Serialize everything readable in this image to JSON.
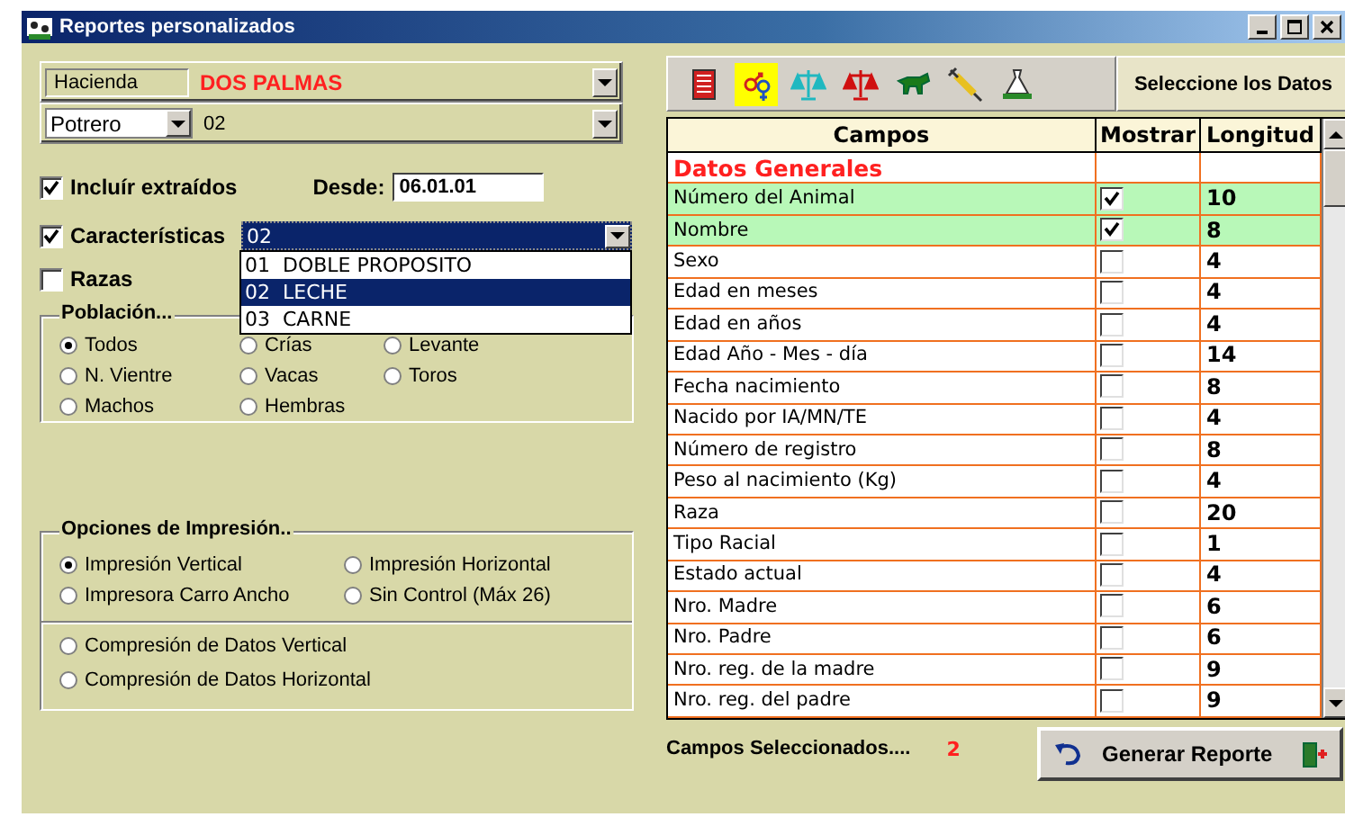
{
  "window": {
    "title": "Reportes personalizados"
  },
  "hacienda": {
    "label": "Hacienda",
    "value": "DOS PALMAS"
  },
  "potrero": {
    "label": "Potrero",
    "value": "02"
  },
  "incluir": {
    "label": "Incluír extraídos",
    "checked": true
  },
  "desde": {
    "label": "Desde:",
    "value": "06.01.01"
  },
  "caracteristicas": {
    "label": "Características",
    "checked": true,
    "value": "02",
    "options": [
      {
        "label": "01  DOBLE PROPOSITO",
        "selected": false
      },
      {
        "label": "02  LECHE",
        "selected": true
      },
      {
        "label": "03  CARNE",
        "selected": false
      }
    ]
  },
  "razas": {
    "label": "Razas",
    "checked": false
  },
  "poblacion": {
    "title": "Población...",
    "options": [
      {
        "label": "Todos",
        "selected": true
      },
      {
        "label": "Crías",
        "selected": false
      },
      {
        "label": "Levante",
        "selected": false
      },
      {
        "label": "N. Vientre",
        "selected": false
      },
      {
        "label": "Vacas",
        "selected": false
      },
      {
        "label": "Toros",
        "selected": false
      },
      {
        "label": "Machos",
        "selected": false
      },
      {
        "label": "Hembras",
        "selected": false
      }
    ]
  },
  "impresion": {
    "title": "Opciones de Impresión..",
    "options": [
      {
        "label": "Impresión Vertical",
        "selected": true
      },
      {
        "label": "Impresión Horizontal",
        "selected": false
      },
      {
        "label": "Impresora Carro Ancho",
        "selected": false
      },
      {
        "label": "Sin Control (Máx 26)",
        "selected": false
      }
    ],
    "compression": [
      {
        "label": "Compresión de Datos Vertical",
        "selected": false
      },
      {
        "label": "Compresión de Datos Horizontal",
        "selected": false
      }
    ]
  },
  "toolbar": {
    "tools": [
      {
        "kind": "document",
        "selected": false
      },
      {
        "kind": "gender",
        "selected": true
      },
      {
        "kind": "scale",
        "color": "#20b8c0",
        "selected": false
      },
      {
        "kind": "scale",
        "color": "#d01010",
        "selected": false
      },
      {
        "kind": "animal",
        "selected": false
      },
      {
        "kind": "syringe",
        "selected": false
      },
      {
        "kind": "sack",
        "selected": false
      }
    ],
    "label": "Seleccione los Datos"
  },
  "table": {
    "columns": [
      "Campos",
      "Mostrar",
      "Longitud"
    ],
    "rows": [
      {
        "kind": "section",
        "campo": "Datos Generales"
      },
      {
        "kind": "field",
        "campo": "Número del Animal",
        "mostrar": true,
        "longitud": "10"
      },
      {
        "kind": "field",
        "campo": "Nombre",
        "mostrar": true,
        "longitud": "8"
      },
      {
        "kind": "field",
        "campo": "Sexo",
        "mostrar": false,
        "longitud": "4"
      },
      {
        "kind": "field",
        "campo": "Edad en meses",
        "mostrar": false,
        "longitud": "4"
      },
      {
        "kind": "field",
        "campo": "Edad en años",
        "mostrar": false,
        "longitud": "4"
      },
      {
        "kind": "field",
        "campo": "Edad Año - Mes - día",
        "mostrar": false,
        "longitud": "14"
      },
      {
        "kind": "field",
        "campo": "Fecha nacimiento",
        "mostrar": false,
        "longitud": "8"
      },
      {
        "kind": "field",
        "campo": "Nacido por IA/MN/TE",
        "mostrar": false,
        "longitud": "4"
      },
      {
        "kind": "field",
        "campo": "Número de registro",
        "mostrar": false,
        "longitud": "8"
      },
      {
        "kind": "field",
        "campo": "Peso al nacimiento (Kg)",
        "mostrar": false,
        "longitud": "4"
      },
      {
        "kind": "field",
        "campo": "Raza",
        "mostrar": false,
        "longitud": "20"
      },
      {
        "kind": "field",
        "campo": "Tipo Racial",
        "mostrar": false,
        "longitud": "1"
      },
      {
        "kind": "field",
        "campo": "Estado actual",
        "mostrar": false,
        "longitud": "4"
      },
      {
        "kind": "field",
        "campo": "Nro. Madre",
        "mostrar": false,
        "longitud": "6"
      },
      {
        "kind": "field",
        "campo": "Nro. Padre",
        "mostrar": false,
        "longitud": "6"
      },
      {
        "kind": "field",
        "campo": "Nro. reg. de la madre",
        "mostrar": false,
        "longitud": "9"
      },
      {
        "kind": "field",
        "campo": "Nro. reg. del padre",
        "mostrar": false,
        "longitud": "9"
      }
    ]
  },
  "footer": {
    "label": "Campos Seleccionados....",
    "count": "2",
    "button": "Generar Reporte"
  }
}
